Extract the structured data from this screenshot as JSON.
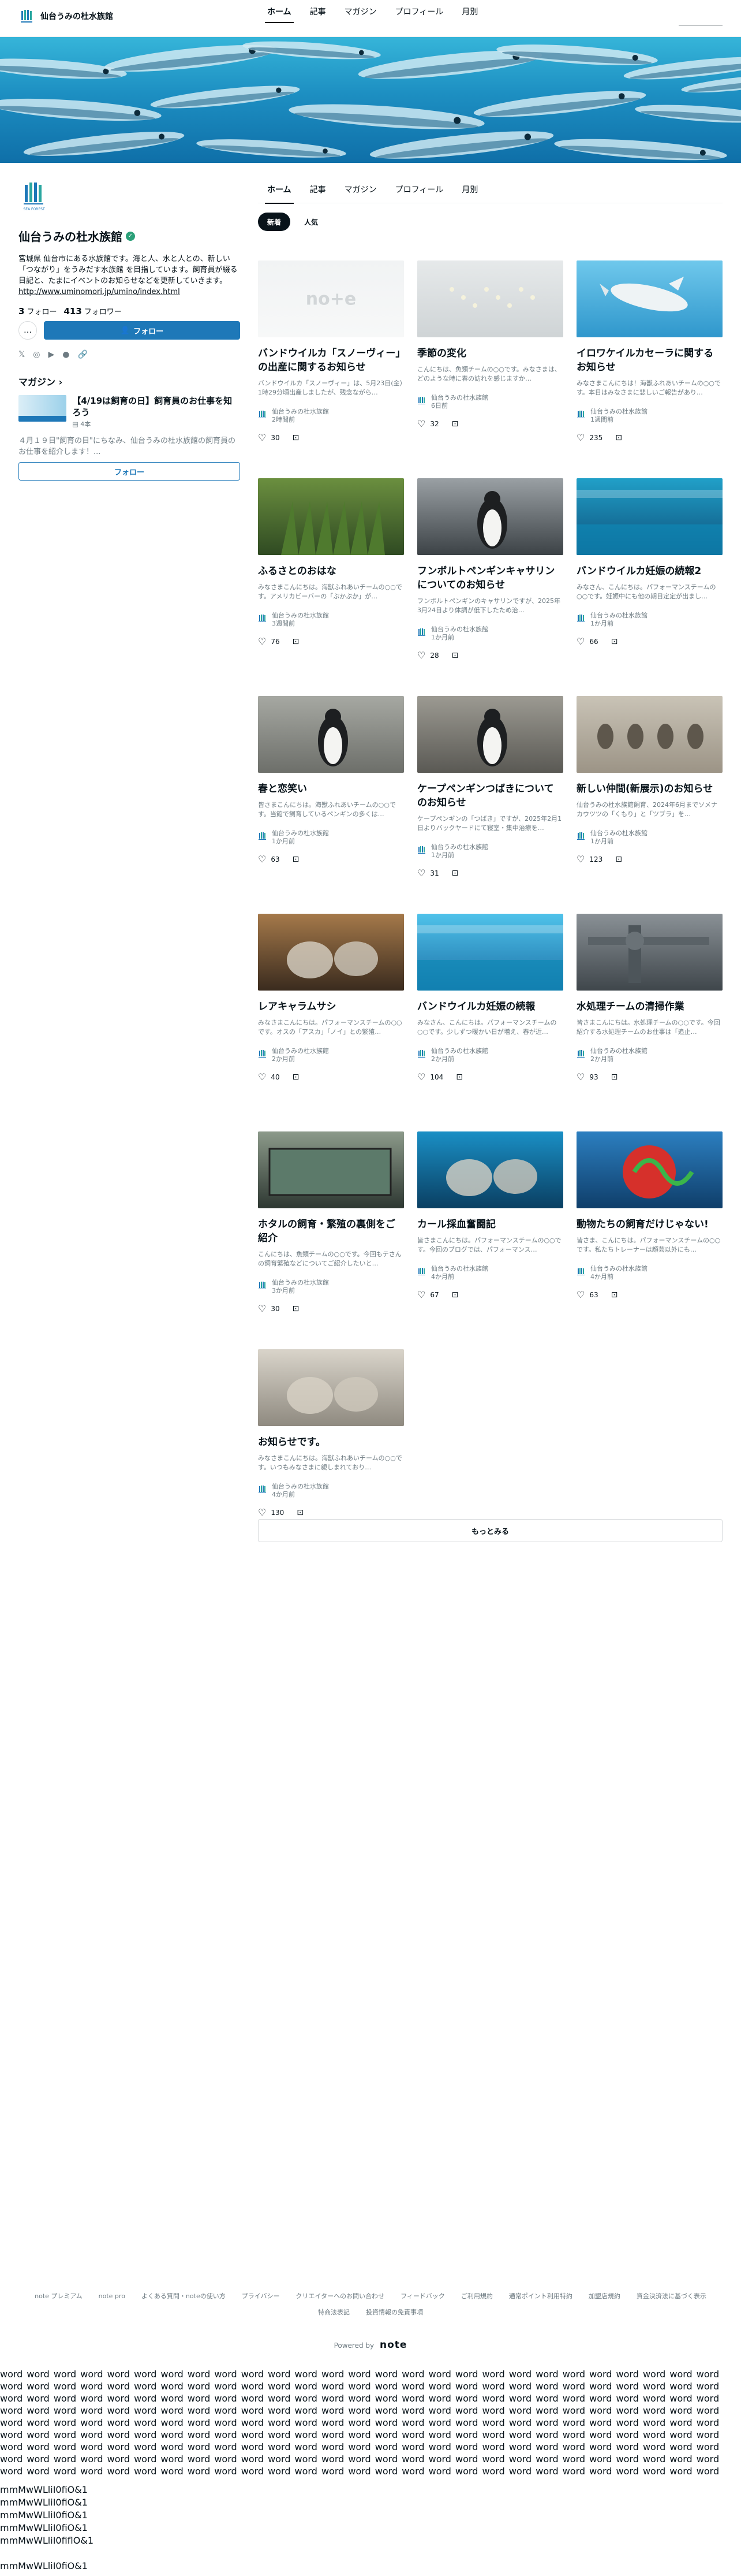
{
  "header": {
    "site_name": "仙台うみの杜水族館",
    "nav": [
      "ホーム",
      "記事",
      "マガジン",
      "プロフィール",
      "月別"
    ]
  },
  "sidebar": {
    "name": "仙台うみの杜水族館",
    "logo_text": "SEA FOREST",
    "bio": "宮城県 仙台市にある水族館です。海と人、水と人との、新しい「つながり」をうみだす水族館 を目指しています。飼育員が綴る日記と、たまにイベントのお知らせなどを更新していきます。",
    "bio_link": "http://www.uminomori.jp/umino/index.html",
    "following_count": "3",
    "following_label": "フォロー",
    "follower_count": "413",
    "follower_label": "フォロワー",
    "more_label": "…",
    "follow_label": "フォロー",
    "magazine_heading": "マガジン",
    "magazine": {
      "title": "【4/19は飼育の日】飼育員のお仕事を知ろう",
      "meta": "4本",
      "description": "４月１９日\"飼育の日\"にちなみ、仙台うみの杜水族館の飼育員のお仕事を紹介します！...",
      "follow_label": "フォロー"
    }
  },
  "main": {
    "tabs": [
      "ホーム",
      "記事",
      "マガジン",
      "プロフィール",
      "月別"
    ],
    "sort": [
      "新着",
      "人気"
    ],
    "more_label": "もっとみる"
  },
  "articles": [
    {
      "title": "バンドウイルカ「スノーヴィー」の出産に関するお知らせ",
      "excerpt": "バンドウイルカ「スノーヴィー」は、5月23日(金）1時29分頃出産しましたが、残念ながら…",
      "author": "仙台うみの杜水族館",
      "time": "2時間前",
      "likes": "30",
      "thumb": "note"
    },
    {
      "title": "季節の変化",
      "excerpt": "こんにちは、魚類チームの○○です。みなさまは、どのような時に春の訪れを感じますか…",
      "author": "仙台うみの杜水族館",
      "time": "6日前",
      "likes": "32",
      "thumb": "jelly"
    },
    {
      "title": "イロワケイルカセーラに関するお知らせ",
      "excerpt": "みなさまこんにちは！海獣ふれあいチームの○○です。本日はみなさまに悲しいご報告があり…",
      "author": "仙台うみの杜水族館",
      "time": "1週間前",
      "likes": "235",
      "thumb": "dolphin"
    },
    {
      "title": "ふるさとのおはな",
      "excerpt": "みなさまこんにちは。海獣ふれあいチームの○○です。アメリカビーバーの「ぷかぷか」が…",
      "author": "仙台うみの杜水族館",
      "time": "3週間前",
      "likes": "76",
      "thumb": "plant"
    },
    {
      "title": "フンボルトペンギンキャサリンについてのお知らせ",
      "excerpt": "フンボルトペンギンのキャサリンですが、2025年3月24日より体調が低下したため治…",
      "author": "仙台うみの杜水族館",
      "time": "1か月前",
      "likes": "28",
      "thumb": "penguin"
    },
    {
      "title": "バンドウイルカ妊娠の続報2",
      "excerpt": "みなさん、こんにちは。パフォーマンスチームの○○です。妊娠中にも他の期日定定が出まし…",
      "author": "仙台うみの杜水族館",
      "time": "1か月前",
      "likes": "66",
      "thumb": "pool"
    },
    {
      "title": "春と恋笑い",
      "excerpt": "皆さまこんにちは。海獣ふれあいチームの○○です。当館で飼育しているペンギンの多くは…",
      "author": "仙台うみの杜水族館",
      "time": "1か月前",
      "likes": "63",
      "thumb": "penguins"
    },
    {
      "title": "ケープペンギンつばきについてのお知らせ",
      "excerpt": "ケープペンギンの「つばき」ですが、2025年2月1日よりバックヤードにて寝室・集中治療を…",
      "author": "仙台うみの杜水族館",
      "time": "1か月前",
      "likes": "31",
      "thumb": "capepenguin"
    },
    {
      "title": "新しい仲間(新展示)のお知らせ",
      "excerpt": "仙台うみの杜水族館飼育、2024年6月までソメナカウツツの「くもり」と「ツブラ」を…",
      "author": "仙台うみの杜水族館",
      "time": "1か月前",
      "likes": "123",
      "thumb": "birds"
    },
    {
      "title": "レアキャラムサシ",
      "excerpt": "みなさまこんにちは。パフォーマンスチームの○○です。オスの「アスカ」「ノイ」との繁殖…",
      "author": "仙台うみの杜水族館",
      "time": "2か月前",
      "likes": "40",
      "thumb": "sealion"
    },
    {
      "title": "バンドウイルカ妊娠の続報",
      "excerpt": "みなさん、こんにちは。パフォーマンスチームの○○です。少しずつ暖かい日が増え、春が近…",
      "author": "仙台うみの杜水族館",
      "time": "2か月前",
      "likes": "104",
      "thumb": "show"
    },
    {
      "title": "水処理チームの清掃作業",
      "excerpt": "皆さまこんにちは。水処理チームの○○です。今回紹介する水処理チームのお仕事は「追止…",
      "author": "仙台うみの杜水族館",
      "time": "2か月前",
      "likes": "93",
      "thumb": "pipes"
    },
    {
      "title": "ホタルの飼育・繁殖の裏側をご紹介",
      "excerpt": "こんにちは、魚類チームの○○です。今回もテさんの飼育繁殖などについてご紹介したいと…",
      "author": "仙台うみの杜水族館",
      "time": "3か月前",
      "likes": "30",
      "thumb": "tank"
    },
    {
      "title": "カール採血奮闘記",
      "excerpt": "皆さまこんにちは。パフォーマンスチームの○○です。今回のブログでは、パフォーマンス…",
      "author": "仙台うみの杜水族館",
      "time": "4か月前",
      "likes": "67",
      "thumb": "seal"
    },
    {
      "title": "動物たちの飼育だけじゃない!",
      "excerpt": "皆さま、こんにちは。パフォーマンスチームの○○です。私たちトレーナーは顔芸以外にも…",
      "author": "仙台うみの杜水族館",
      "time": "4か月前",
      "likes": "63",
      "thumb": "snake"
    },
    {
      "title": "お知らせです。",
      "excerpt": "みなさまこんにちは。海獣ふれあいチームの○○です。いつもみなさまに親しまれており…",
      "author": "仙台うみの杜水族館",
      "time": "4か月前",
      "likes": "130",
      "thumb": "seals"
    }
  ],
  "footer": {
    "links": [
      "note プレミアム",
      "note pro",
      "よくある質問・noteの使い方",
      "プライバシー",
      "クリエイターへのお問い合わせ",
      "フィードバック",
      "ご利用規約",
      "通常ポイント利用特約",
      "加盟店規約",
      "資金決済法に基づく表示",
      "特商法表記",
      "投資情報の免責事項"
    ],
    "powered_by": "Powered by",
    "powered_brand": "note"
  },
  "test_text": {
    "words": "word word word word word word word word word word word word word word word word word word word word word word word word word word word word word word word word word word word word word word word word word word word word word word word word word word word word word word word word word word word word word word word word word word word word word word word word word word word word word word word word word word word word word word word word word word word word word word word word word word word word word word word word word word word word word word word word word word word word word word word word word word word word word word word word word word word word word word word word word word word word word word word word word word word word word word word word word word word word word word word word word word word word word word word word word word word word word word word word word word word word word word word word word word word word word word word word word word word word word word word word word word word word word word word word word word word word word word word word word word word word word word word word word word word word word word word word word word word word word word word word word word word",
    "mono_lines": [
      "mmMwWLliI0fiO&1",
      "mmMwWLliI0fiO&1",
      "mmMwWLliI0fiO&1",
      "mmMwWLliI0fiO&1",
      "mmMwWLliI0fiflO&1",
      "",
      "mmMwWLliI0fiO&1"
    ]
  },
  "colors": {
    "accent": "#1e78b8",
    "verified": "#2ba079",
    "text": "#08131a",
    "muted": "#6e7b82"
  }
}
